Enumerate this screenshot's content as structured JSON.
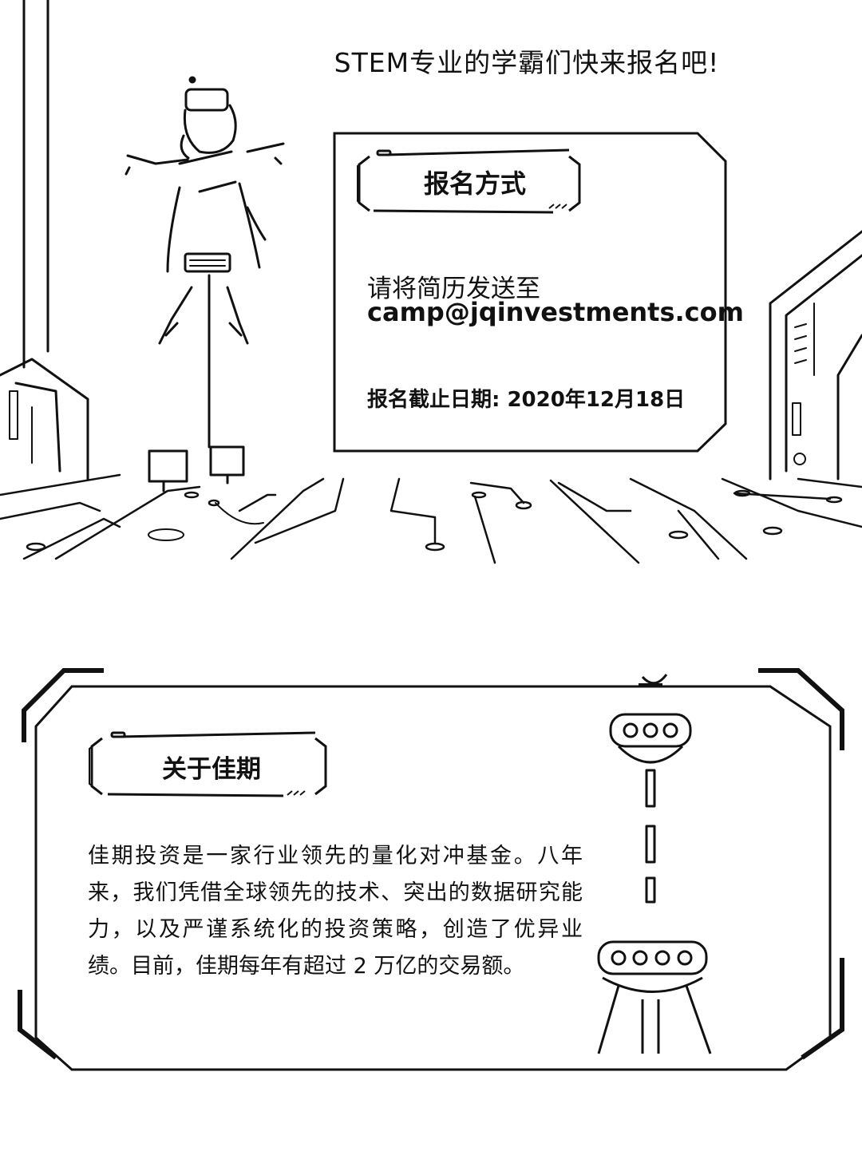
{
  "headline": "STEM专业的学霸们快来报名吧!",
  "signup": {
    "title": "报名方式",
    "intro": "请将简历发送至",
    "email": "camp@jqinvestments.com",
    "deadline": "报名截止日期: 2020年12月18日"
  },
  "about": {
    "title": "关于佳期",
    "body": "佳期投资是一家行业领先的量化对冲基金。八年来，我们凭借全球领先的技术、突出的数据研究能力，以及严谨系统化的投资策略，创造了优异业绩。目前，佳期每年有超过 2 万亿的交易额。"
  },
  "colors": {
    "ink": "#111111",
    "background": "#ffffff"
  },
  "icons": [
    "robot-figure-illustration",
    "circuit-floor-illustration",
    "server-panel-illustration",
    "lamp-tower-illustration"
  ]
}
